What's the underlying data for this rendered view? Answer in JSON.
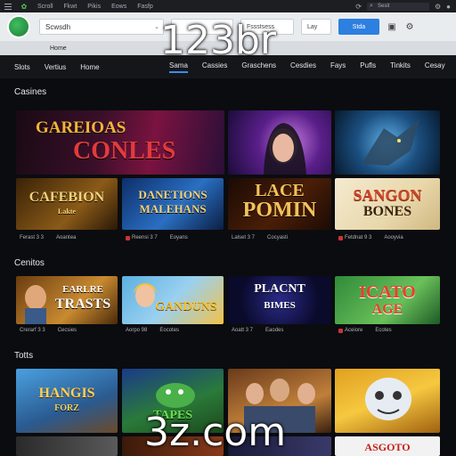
{
  "topbar": {
    "items": [
      "Scroll",
      "Fkwt",
      "Pikis",
      "Eows",
      "Fasfp"
    ],
    "search_placeholder": "Sesit"
  },
  "toolbar": {
    "address_value": "Scwsdh",
    "address2_value": "",
    "field1": "Fssstsess",
    "field2": "Lay",
    "button_label": "Stda"
  },
  "breadcrumb": "Home",
  "nav": {
    "left": [
      "Slots",
      "Vertius",
      "Home"
    ],
    "right": [
      "Sama",
      "Cassies",
      "Graschens",
      "Cesdies",
      "Fays",
      "Pufls",
      "Tinkits",
      "Cesay"
    ],
    "active_index": 0
  },
  "sections": [
    {
      "title": "Casines"
    },
    {
      "title": "Cenitos"
    },
    {
      "title": "Totts"
    }
  ],
  "featured": {
    "title_line1": "GAREIOAS",
    "title_line2": "CONLES"
  },
  "row1": [
    {
      "line1": "CAFEBION",
      "line2": "Lakte",
      "meta_a": "Ferast 3 3",
      "meta_b": "Aoantea"
    },
    {
      "line1": "DANETIONS",
      "line2": "MALEHANS",
      "meta_a": "Reensi 3 7",
      "meta_b": "Eoyans"
    },
    {
      "line1": "LACE",
      "line2": "POMIN",
      "meta_a": "Lalset 3 7",
      "meta_b": "Cocyasti"
    },
    {
      "line1": "SANGON",
      "line2": "BONES",
      "meta_a": "Fetdnat 9 3",
      "meta_b": "Aooyvia"
    }
  ],
  "row2": [
    {
      "line1": "EARLRE",
      "line2": "TRASTS",
      "meta_a": "Crerarf 3 3",
      "meta_b": "Cecsies"
    },
    {
      "line1": "",
      "line2": "GANDUNS",
      "meta_a": "Aorpo 98",
      "meta_b": "Eocotes"
    },
    {
      "line1": "PLACNT",
      "line2": "BIMES",
      "meta_a": "Aoatt 3 7",
      "meta_b": "Eaodes"
    },
    {
      "line1": "ICATO",
      "line2": "AGE",
      "meta_a": "Aceiore",
      "meta_b": "Ecotes"
    }
  ],
  "row3": [
    {
      "line1": "HANGIS",
      "line2": "FORZ"
    },
    {
      "line1": "",
      "line2": "TAPES"
    },
    {
      "line1": "",
      "line2": ""
    },
    {
      "line1": "",
      "line2": ""
    }
  ],
  "bottom_row": [
    {
      "label": ""
    },
    {
      "label": ""
    },
    {
      "label": ""
    },
    {
      "label": "ASGOTO"
    }
  ],
  "watermark": {
    "top": "123br",
    "bottom": "3z.com"
  }
}
